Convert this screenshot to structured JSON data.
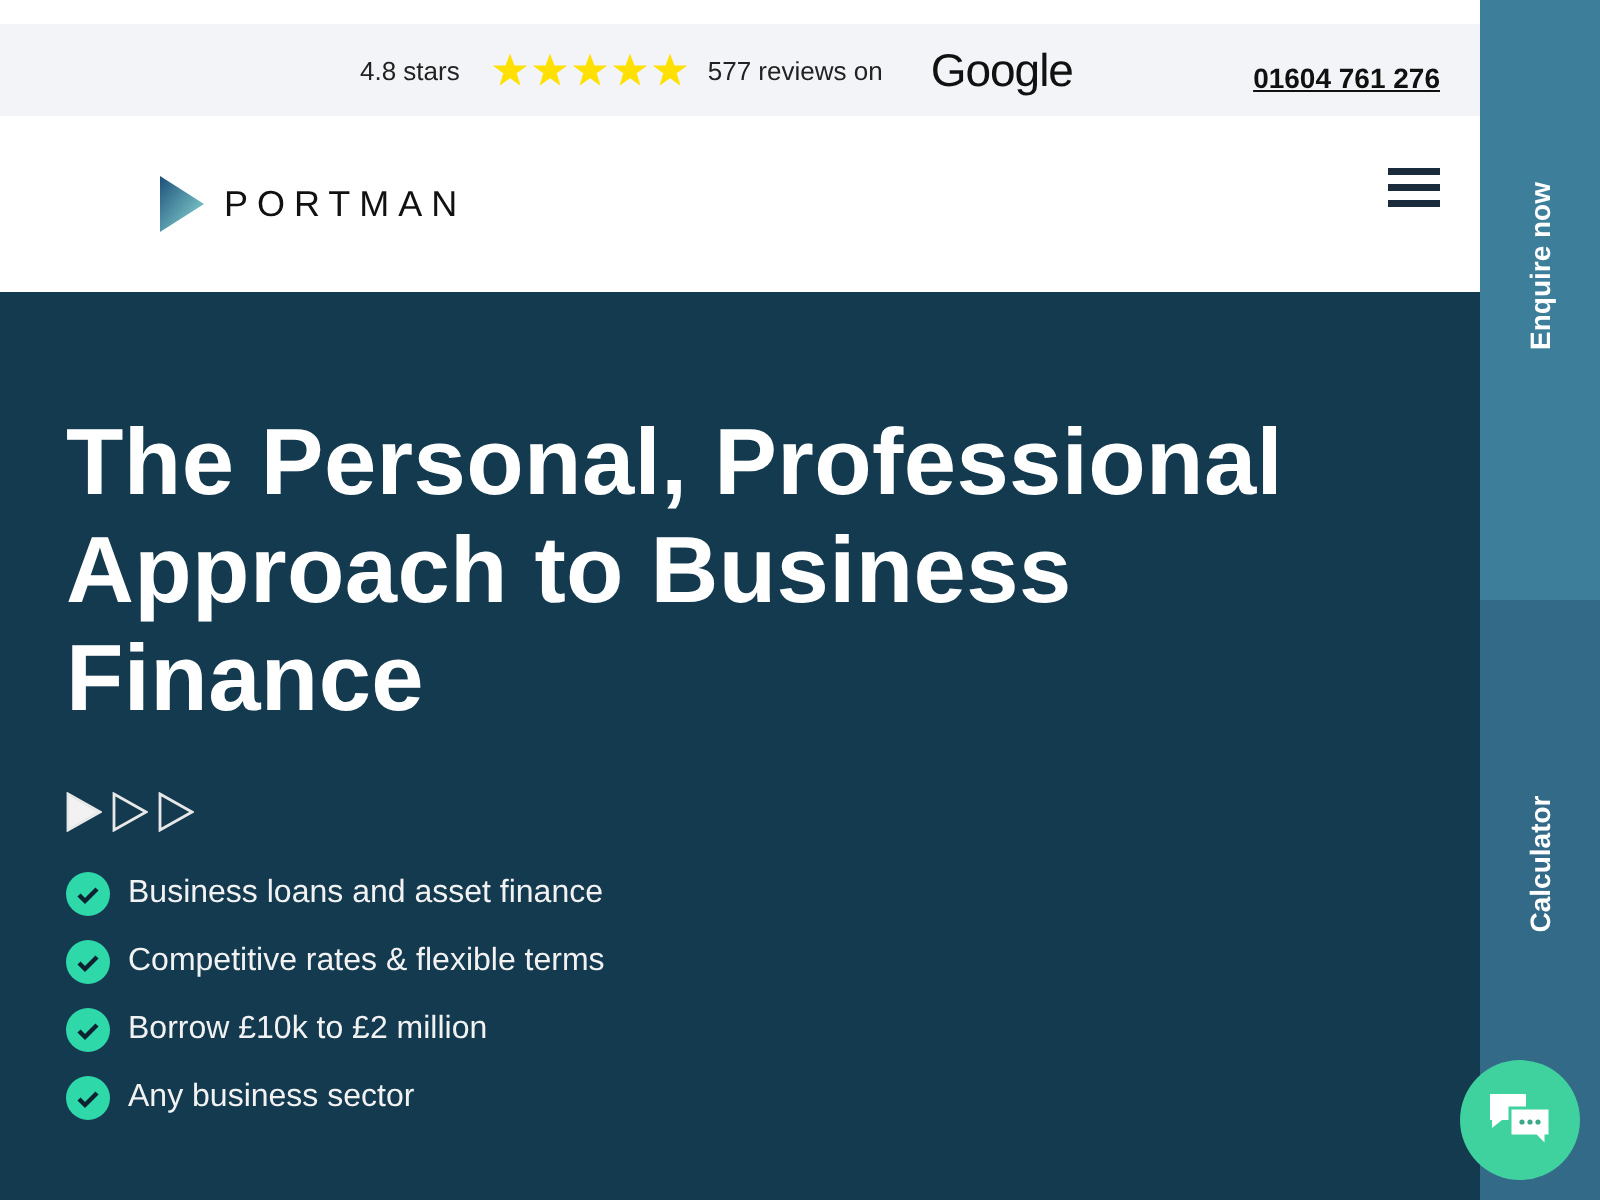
{
  "reviews": {
    "rating_text": "4.8 stars",
    "stars": 5,
    "count_text": "577 reviews on",
    "brand": "Google"
  },
  "phone": "01604 761 276",
  "logo": {
    "text": "PORTMAN"
  },
  "hero": {
    "heading": "The Personal, Professional Approach to Business Finance",
    "slides": [
      {
        "selected": true
      },
      {
        "selected": false
      },
      {
        "selected": false
      }
    ],
    "features": [
      "Business loans and asset finance",
      "Competitive rates & flexible terms",
      "Borrow £10k to £2 million",
      "Any business sector"
    ]
  },
  "side_tabs": [
    {
      "label": "Enquire now"
    },
    {
      "label": "Calculator"
    }
  ]
}
